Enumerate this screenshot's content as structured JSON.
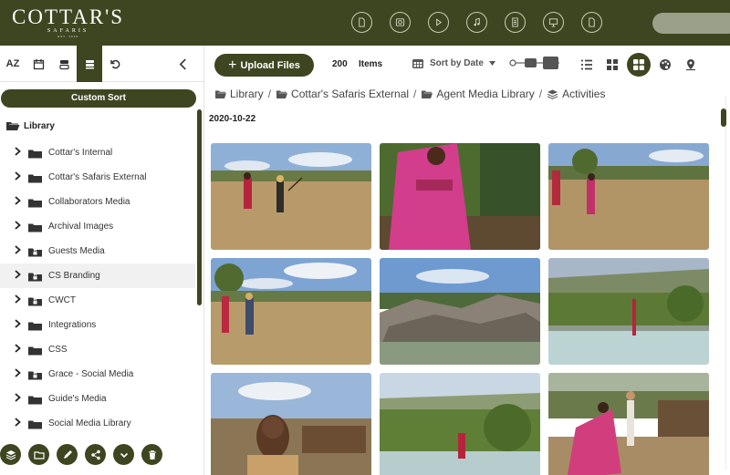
{
  "brand": {
    "name": "COTTAR'S",
    "sub": "SAFARIS",
    "tagline": "EST. 1919"
  },
  "header": {
    "icons": [
      "document-icon",
      "image-icon",
      "play-icon",
      "music-icon",
      "text-file-icon",
      "presentation-icon",
      "file-icon"
    ]
  },
  "sidebar": {
    "sort_label": "Custom Sort",
    "root_label": "Library",
    "items": [
      {
        "label": "Cottar's Internal",
        "locked": false
      },
      {
        "label": "Cottar's Safaris External",
        "locked": false
      },
      {
        "label": "Collaborators Media",
        "locked": false
      },
      {
        "label": "Archival Images",
        "locked": false
      },
      {
        "label": "Guests Media",
        "locked": true
      },
      {
        "label": "CS Branding",
        "locked": true
      },
      {
        "label": "CWCT",
        "locked": true
      },
      {
        "label": "Integrations",
        "locked": false
      },
      {
        "label": "CSS",
        "locked": false
      },
      {
        "label": "Grace - Social Media",
        "locked": true
      },
      {
        "label": "Guide's Media",
        "locked": false
      },
      {
        "label": "Social Media Library",
        "locked": false
      }
    ],
    "selected_index": 5
  },
  "toolbar": {
    "upload_label": "Upload Files",
    "count": "200",
    "items_label": "Items",
    "sort_label": "Sort by Date",
    "az_label": "AZ"
  },
  "breadcrumb": [
    "Library",
    "Cottar's Safaris External",
    "Agent Media Library",
    "Activities"
  ],
  "date_group": "2020-10-22",
  "colors": {
    "brand": "#3d4620",
    "brand_light": "#9aa08a"
  }
}
